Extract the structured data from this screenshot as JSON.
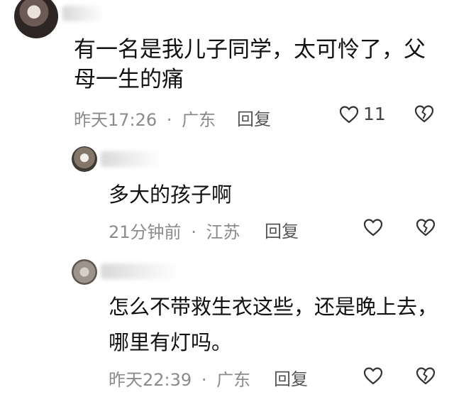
{
  "comments": [
    {
      "lines": [
        "有一名是我儿子同学，太可怜了，父",
        "母一生的痛"
      ],
      "time": "昨天17:26",
      "separator": "·",
      "location": "广东",
      "reply_label": "回复",
      "like_count": "11"
    },
    {
      "lines": [
        "多大的孩子啊"
      ],
      "time": "21分钟前",
      "separator": "·",
      "location": "江苏",
      "reply_label": "回复",
      "like_count": ""
    },
    {
      "lines": [
        "怎么不带救生衣这些，还是晚上去，",
        "哪里有灯吗。"
      ],
      "time": "昨天22:39",
      "separator": "·",
      "location": "广东",
      "reply_label": "回复",
      "like_count": ""
    }
  ],
  "colors": {
    "text": "#111111",
    "meta": "#8b8b8b",
    "icon": "#333333"
  },
  "icons": [
    "heart-outline-icon",
    "broken-heart-icon"
  ]
}
